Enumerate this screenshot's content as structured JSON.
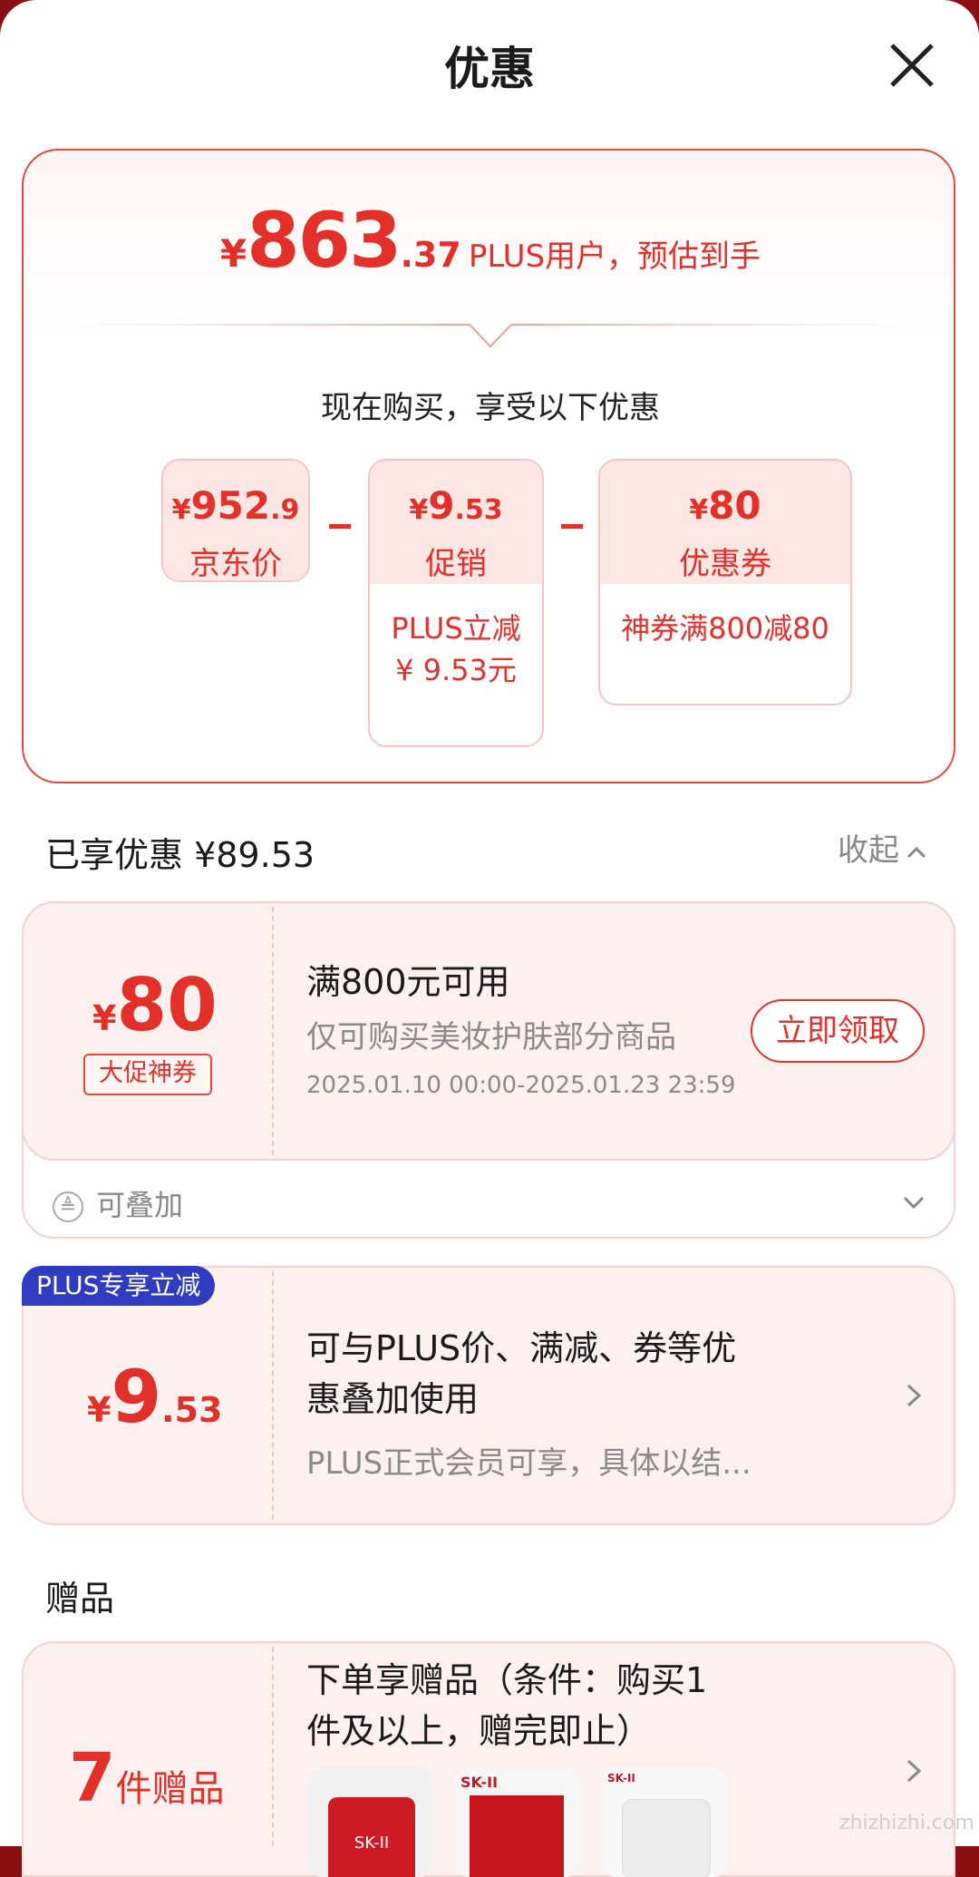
{
  "header": {
    "title": "优惠"
  },
  "estimate": {
    "currency": "¥",
    "integer": "863",
    "decimal": ".37",
    "label": "PLUS用户，预估到手"
  },
  "subtitle": "现在购买，享受以下优惠",
  "breakdown": [
    {
      "currency": "¥",
      "amount_main": "952",
      "amount_sub": ".9",
      "name": "京东价",
      "detail": ""
    },
    {
      "currency": "¥",
      "amount_main": "9",
      "amount_sub": ".53",
      "name": "促销",
      "detail_lines": [
        "PLUS立减",
        "¥ 9.53元"
      ]
    },
    {
      "currency": "¥",
      "amount_main": "80",
      "amount_sub": "",
      "name": "优惠券",
      "detail_lines": [
        "神券满800减80"
      ]
    }
  ],
  "saved": {
    "label": "已享优惠 ¥89.53",
    "collapse_label": "收起"
  },
  "coupon": {
    "currency": "¥",
    "amount": "80",
    "tag": "大促神券",
    "title": "满800元可用",
    "desc": "仅可购买美妆护肤部分商品",
    "period": "2025.01.10 00:00-2025.01.23 23:59",
    "claim_label": "立即领取",
    "stack_label": "可叠加",
    "stack_icon_glyph": "≜"
  },
  "plus": {
    "badge": "PLUS专享立减",
    "currency": "¥",
    "amount_main": "9",
    "amount_sub": ".53",
    "title_lines": [
      "可与PLUS价、满减、券等优",
      "惠叠加使用"
    ],
    "desc": "PLUS正式会员可享，具体以结..."
  },
  "gifts": {
    "section_title": "赠品",
    "count_num": "7",
    "count_label": "件赠品",
    "title_lines": [
      "下单享赠品（条件：购买1",
      "件及以上，赠完即止）"
    ],
    "thumb_labels": [
      "SK-II",
      "SK-II",
      "SK-II"
    ]
  },
  "watermark": "zhizhizhi.com",
  "colors": {
    "accent": "#e3302a",
    "plus_badge": "#2f3cbf",
    "card_bg": "#fdf1ef"
  }
}
